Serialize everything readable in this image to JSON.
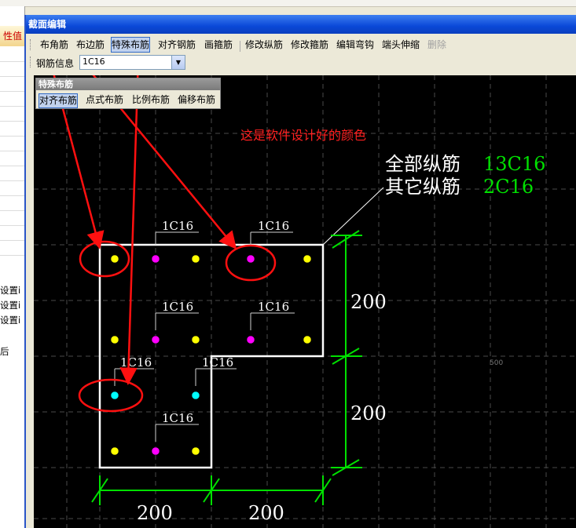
{
  "left_panel": {
    "header": "性值",
    "texts": [
      "设置i",
      "设置i",
      "设置i",
      "后"
    ]
  },
  "window": {
    "title": "截面编辑"
  },
  "toolbar": {
    "items": [
      "布角筋",
      "布边筋",
      "特殊布筋",
      "对齐钢筋",
      "画箍筋",
      "修改纵筋",
      "修改箍筋",
      "编辑弯钩",
      "端头伸缩",
      "删除"
    ]
  },
  "rebar_info": {
    "label": "钢筋信息",
    "value": "1C16"
  },
  "special_panel": {
    "title": "特殊布筋",
    "buttons": [
      "对齐布筋",
      "点式布筋",
      "比例布筋",
      "偏移布筋"
    ]
  },
  "annotations": {
    "red_note": "这是软件设计好的颜色",
    "all_label": "全部纵筋",
    "all_value": "13C16",
    "other_label": "其它纵筋",
    "other_value": "2C16",
    "bar_labels": [
      "1C16",
      "1C16",
      "1C16",
      "1C16",
      "1C16",
      "1C16",
      "1C16"
    ],
    "dim_right_top": "200",
    "dim_right_bottom": "200",
    "dim_bottom_left": "200",
    "dim_bottom_right": "200",
    "coord_500": "500"
  },
  "colors": {
    "outline": "#ffffff",
    "dimension": "#00e000",
    "corner_bar": "#ffff00",
    "other_bar": "#ff00ff",
    "cyan_bar": "#00ffff",
    "arrow": "#ff0000",
    "grid": "#505050"
  }
}
